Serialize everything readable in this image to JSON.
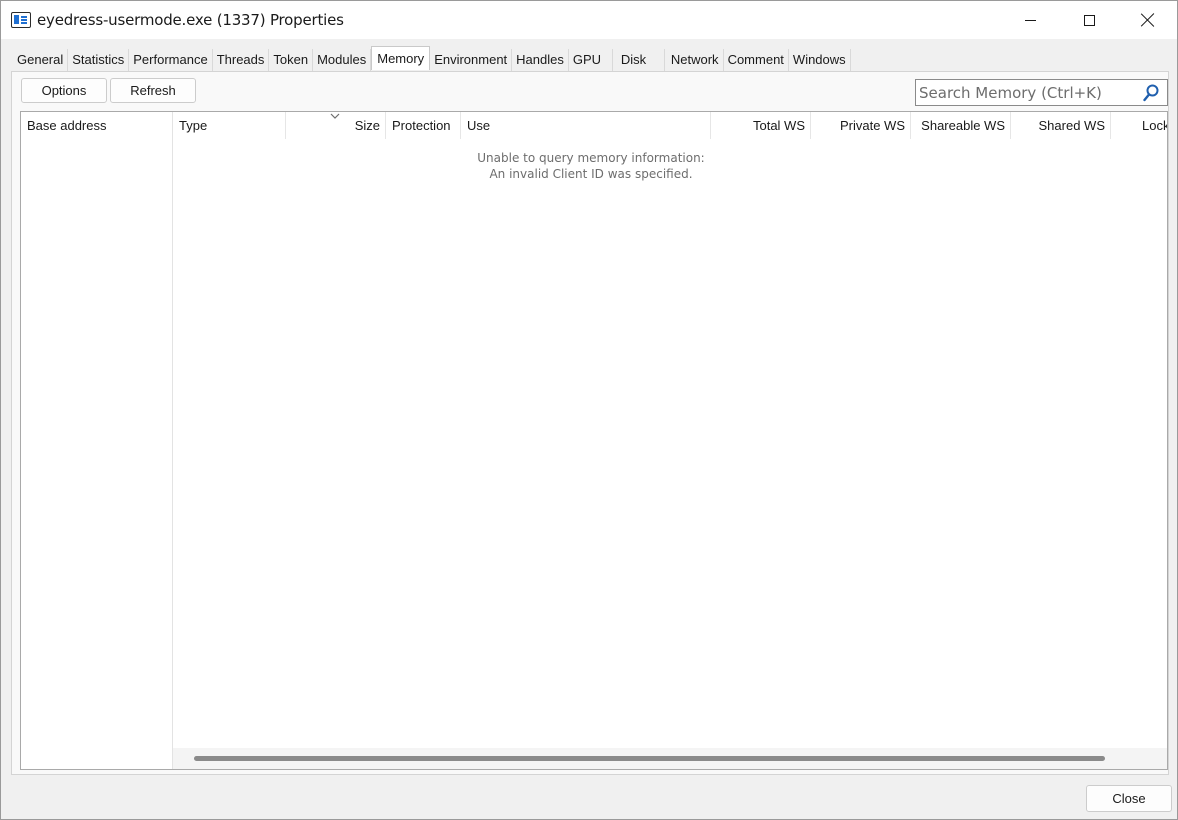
{
  "window": {
    "title": "eyedress-usermode.exe (1337) Properties"
  },
  "tabs": [
    {
      "label": "General"
    },
    {
      "label": "Statistics"
    },
    {
      "label": "Performance"
    },
    {
      "label": "Threads"
    },
    {
      "label": "Token"
    },
    {
      "label": "Modules"
    },
    {
      "label": "Memory",
      "active": true
    },
    {
      "label": "Environment"
    },
    {
      "label": "Handles"
    },
    {
      "label": "GPU"
    },
    {
      "label": "Disk"
    },
    {
      "label": "Network"
    },
    {
      "label": "Comment"
    },
    {
      "label": "Windows"
    }
  ],
  "toolbar": {
    "options_label": "Options",
    "refresh_label": "Refresh",
    "search_placeholder": "Search Memory (Ctrl+K)",
    "search_value": ""
  },
  "table": {
    "columns": {
      "base_address": "Base address",
      "type": "Type",
      "size": "Size",
      "protection": "Protection",
      "use": "Use",
      "total_ws": "Total WS",
      "private_ws": "Private WS",
      "shareable_ws": "Shareable WS",
      "shared_ws": "Shared WS",
      "locked": "Lock"
    },
    "sorted_column": "size",
    "sort_direction": "descending",
    "rows": [],
    "empty_message_line1": "Unable to query memory information:",
    "empty_message_line2": "An invalid Client ID was specified."
  },
  "footer": {
    "close_label": "Close"
  },
  "icons": {
    "app": "window-properties-icon",
    "search": "search-icon",
    "sort": "chevron-down-icon"
  }
}
